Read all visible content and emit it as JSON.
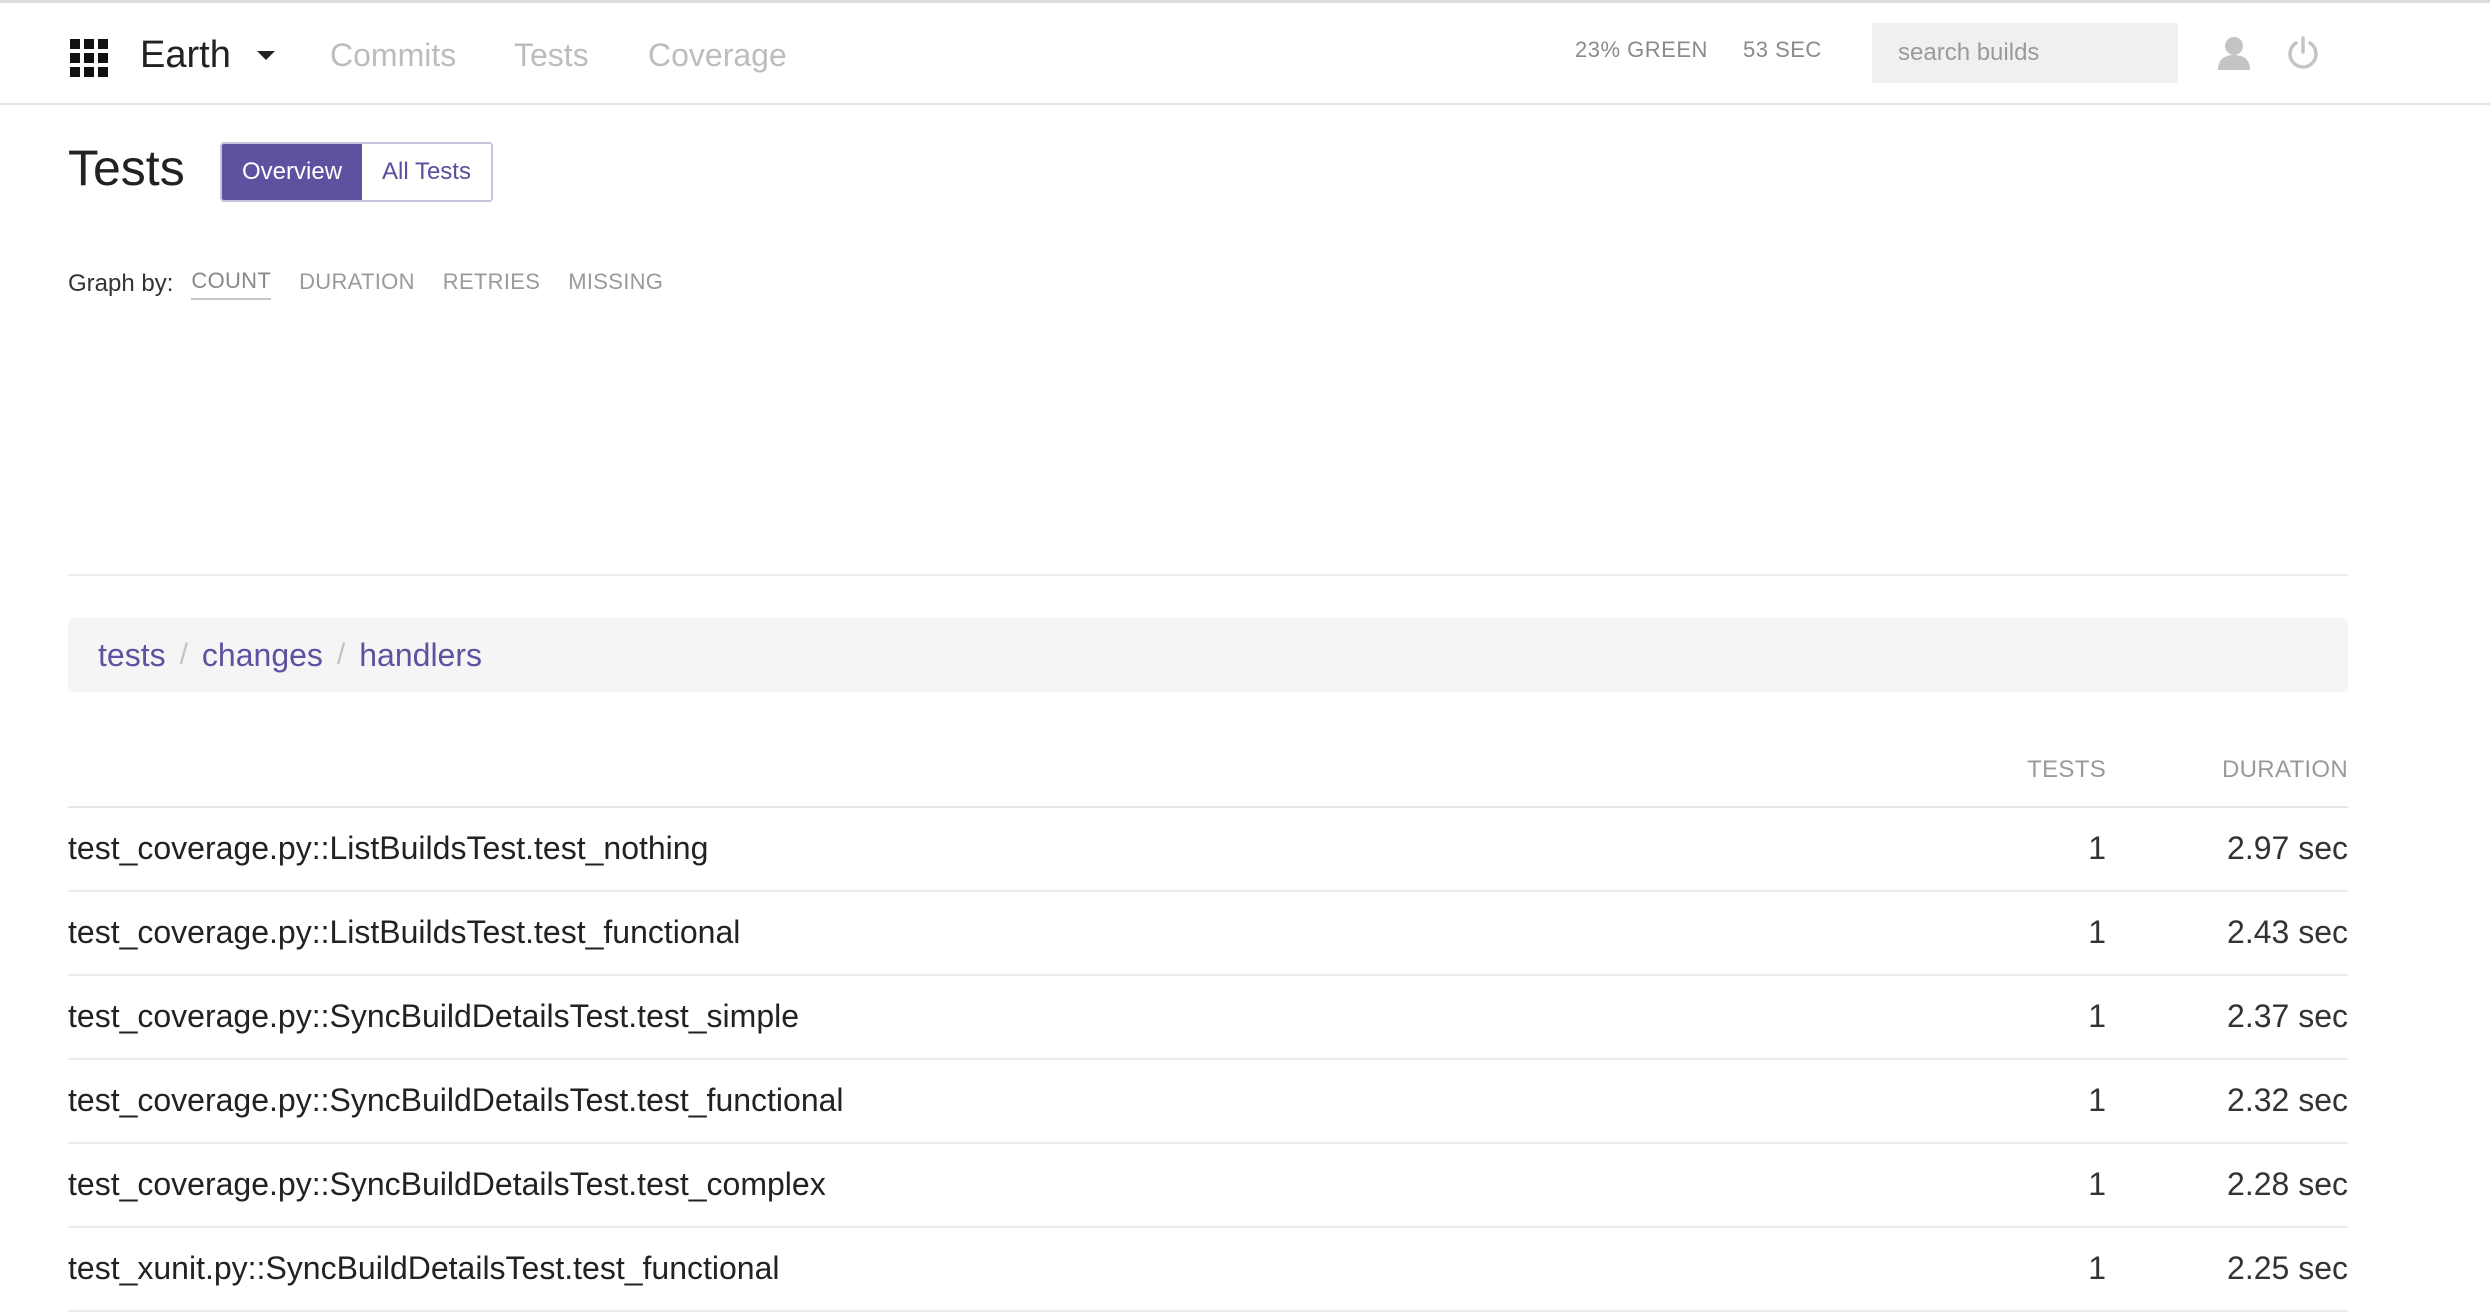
{
  "navbar": {
    "project": "Earth",
    "links": [
      "Commits",
      "Tests",
      "Coverage"
    ],
    "green_stat": "23% GREEN",
    "time_stat": "53 SEC",
    "search_placeholder": "search builds",
    "icons": [
      "apps-grid-icon",
      "caret-down-icon",
      "user-icon",
      "power-icon"
    ]
  },
  "page": {
    "title": "Tests",
    "tabs": [
      {
        "label": "Overview",
        "active": true
      },
      {
        "label": "All Tests",
        "active": false
      }
    ]
  },
  "graph_by": {
    "label": "Graph by:",
    "options": [
      "COUNT",
      "DURATION",
      "RETRIES",
      "MISSING"
    ],
    "selected": "COUNT"
  },
  "breadcrumb": [
    "tests",
    "changes",
    "handlers"
  ],
  "table": {
    "headers": {
      "tests": "TESTS",
      "duration": "DURATION"
    },
    "rows": [
      {
        "name": "test_coverage.py::ListBuildsTest.test_nothing",
        "tests": "1",
        "duration": "2.97 sec"
      },
      {
        "name": "test_coverage.py::ListBuildsTest.test_functional",
        "tests": "1",
        "duration": "2.43 sec"
      },
      {
        "name": "test_coverage.py::SyncBuildDetailsTest.test_simple",
        "tests": "1",
        "duration": "2.37 sec"
      },
      {
        "name": "test_coverage.py::SyncBuildDetailsTest.test_functional",
        "tests": "1",
        "duration": "2.32 sec"
      },
      {
        "name": "test_coverage.py::SyncBuildDetailsTest.test_complex",
        "tests": "1",
        "duration": "2.28 sec"
      },
      {
        "name": "test_xunit.py::SyncBuildDetailsTest.test_functional",
        "tests": "1",
        "duration": "2.25 sec"
      }
    ]
  },
  "colors": {
    "accent": "#5f51a0",
    "nav_link": "#bdbdbd",
    "breadcrumb_bg": "#f5f5f5"
  }
}
